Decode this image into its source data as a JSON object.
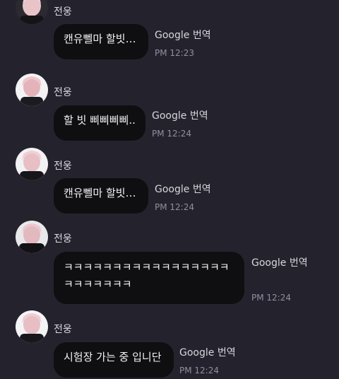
{
  "messages": [
    {
      "sender": "전웅",
      "text": "캔유뻴마 할빗…",
      "translate_label": "Google 번역",
      "time": "PM 12:23",
      "avatar_icon": "profile-avatar-icon"
    },
    {
      "sender": "전웅",
      "text": "할 빗 삐삐삐삐..",
      "translate_label": "Google 번역",
      "time": "PM 12:24",
      "avatar_icon": "profile-avatar-icon"
    },
    {
      "sender": "전웅",
      "text": "캔유뻴마 할빗…",
      "translate_label": "Google 번역",
      "time": "PM 12:24",
      "avatar_icon": "profile-avatar-icon"
    },
    {
      "sender": "전웅",
      "text": "ㅋㅋㅋㅋㅋㅋㅋㅋㅋㅋㅋㅋㅋㅋㅋㅋㅋㅋㅋㅋㅋㅋㅋㅋ",
      "translate_label": "Google 번역",
      "time": "PM 12:24",
      "avatar_icon": "profile-avatar-icon"
    },
    {
      "sender": "전웅",
      "text": "시험장 가는 중 입니단",
      "translate_label": "Google 번역",
      "time": "PM 12:24",
      "avatar_icon": "profile-avatar-icon"
    }
  ],
  "colors": {
    "background": "#24232d",
    "bubble": "#0f0f12",
    "time": "#8f8fa0"
  }
}
